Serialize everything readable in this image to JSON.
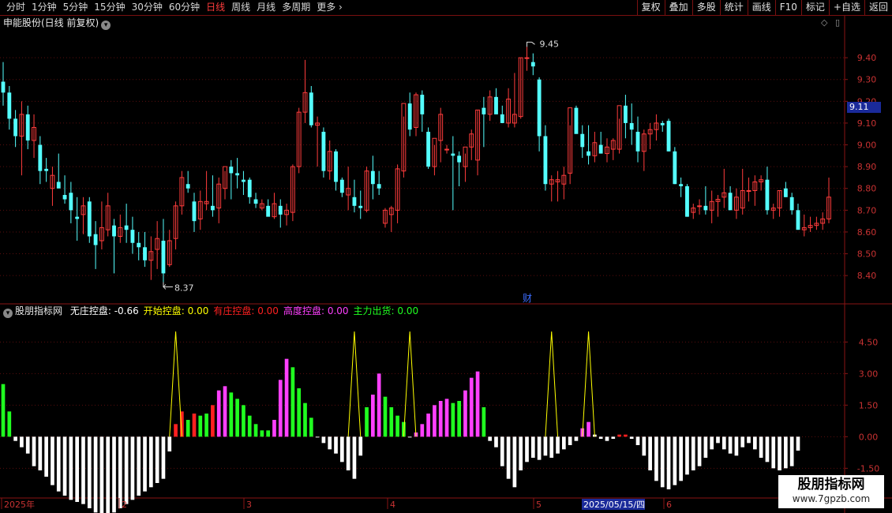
{
  "toolbar": {
    "periods": [
      "分时",
      "1分钟",
      "5分钟",
      "15分钟",
      "30分钟",
      "60分钟",
      "日线",
      "周线",
      "月线",
      "多周期",
      "更多 ›"
    ],
    "active_period": "日线",
    "right_buttons": [
      "复权",
      "叠加",
      "多股",
      "统计",
      "画线",
      "F10",
      "标记",
      "+自选",
      "返回"
    ]
  },
  "main_chart": {
    "title": "申能股份(日线 前复权)",
    "price_tag": "9.11",
    "y_ticks": [
      "9.40",
      "9.30",
      "9.20",
      "9.10",
      "9.00",
      "8.90",
      "8.80",
      "8.70",
      "8.60",
      "8.50",
      "8.40"
    ],
    "high_label": "9.45",
    "low_label": "8.37",
    "finance_marker": "财",
    "colors": {
      "up": "#ff3c3c",
      "down": "#54ffff"
    }
  },
  "indicator": {
    "name": "股朋指标网",
    "fields": [
      {
        "label": "无庄控盘:",
        "value": "-0.66",
        "color": "#ffffff"
      },
      {
        "label": "开始控盘:",
        "value": "0.00",
        "color": "#ffff00"
      },
      {
        "label": "有庄控盘:",
        "value": "0.00",
        "color": "#ff2020"
      },
      {
        "label": "高度控盘:",
        "value": "0.00",
        "color": "#ff40ff"
      },
      {
        "label": "主力出货:",
        "value": "0.00",
        "color": "#20ff20"
      }
    ],
    "y_ticks": [
      "4.50",
      "3.00",
      "1.50",
      "0.00",
      "-1.50"
    ]
  },
  "time_axis": {
    "labels": [
      "2025年",
      "2",
      "3",
      "4",
      "5",
      "6"
    ],
    "cursor_date": "2025/05/15/四"
  },
  "watermark": {
    "title": "股朋指标网",
    "url": "www.7gpzb.com"
  },
  "chart_data": {
    "type": "candlestick",
    "ohlc": [
      [
        9.29,
        9.38,
        9.18,
        9.24
      ],
      [
        9.24,
        9.27,
        9.07,
        9.12
      ],
      [
        9.12,
        9.16,
        8.99,
        9.04
      ],
      [
        9.04,
        9.2,
        8.86,
        9.14
      ],
      [
        9.14,
        9.18,
        8.98,
        9.02
      ],
      [
        9.02,
        9.14,
        8.94,
        9.08
      ],
      [
        9.0,
        9.04,
        8.82,
        8.88
      ],
      [
        8.89,
        8.94,
        8.83,
        8.88
      ],
      [
        8.8,
        8.9,
        8.72,
        8.86
      ],
      [
        8.83,
        8.96,
        8.8,
        8.8
      ],
      [
        8.77,
        8.86,
        8.73,
        8.75
      ],
      [
        8.78,
        8.83,
        8.64,
        8.7
      ],
      [
        8.67,
        8.76,
        8.56,
        8.66
      ],
      [
        8.68,
        8.76,
        8.59,
        8.72
      ],
      [
        8.74,
        8.76,
        8.55,
        8.58
      ],
      [
        8.59,
        8.65,
        8.43,
        8.54
      ],
      [
        8.56,
        8.74,
        8.52,
        8.62
      ],
      [
        8.61,
        8.78,
        8.58,
        8.72
      ],
      [
        8.63,
        8.66,
        8.41,
        8.58
      ],
      [
        8.58,
        8.68,
        8.55,
        8.62
      ],
      [
        8.63,
        8.73,
        8.55,
        8.61
      ],
      [
        8.61,
        8.67,
        8.5,
        8.55
      ],
      [
        8.55,
        8.6,
        8.47,
        8.53
      ],
      [
        8.53,
        8.6,
        8.44,
        8.47
      ],
      [
        8.47,
        8.58,
        8.38,
        8.51
      ],
      [
        8.52,
        8.65,
        8.43,
        8.57
      ],
      [
        8.56,
        8.66,
        8.37,
        8.41
      ],
      [
        8.45,
        8.61,
        8.44,
        8.56
      ],
      [
        8.57,
        8.74,
        8.52,
        8.72
      ],
      [
        8.72,
        8.88,
        8.68,
        8.85
      ],
      [
        8.82,
        8.88,
        8.78,
        8.8
      ],
      [
        8.74,
        8.78,
        8.6,
        8.65
      ],
      [
        8.66,
        8.79,
        8.61,
        8.74
      ],
      [
        8.73,
        8.88,
        8.7,
        8.74
      ],
      [
        8.72,
        8.86,
        8.67,
        8.7
      ],
      [
        8.71,
        8.85,
        8.64,
        8.82
      ],
      [
        8.8,
        8.88,
        8.75,
        8.9
      ],
      [
        8.9,
        8.93,
        8.75,
        8.87
      ],
      [
        8.87,
        8.94,
        8.8,
        8.86
      ],
      [
        8.84,
        8.88,
        8.77,
        8.83
      ],
      [
        8.84,
        8.85,
        8.73,
        8.76
      ],
      [
        8.75,
        8.78,
        8.71,
        8.73
      ],
      [
        8.71,
        8.75,
        8.7,
        8.73
      ],
      [
        8.72,
        8.75,
        8.68,
        8.67
      ],
      [
        8.67,
        8.78,
        8.66,
        8.73
      ],
      [
        8.72,
        8.75,
        8.62,
        8.68
      ],
      [
        8.68,
        8.73,
        8.63,
        8.7
      ],
      [
        8.69,
        8.91,
        8.65,
        8.9
      ],
      [
        8.9,
        9.17,
        8.87,
        9.15
      ],
      [
        9.15,
        9.39,
        9.1,
        9.24
      ],
      [
        9.24,
        9.27,
        9.08,
        9.09
      ],
      [
        9.09,
        9.13,
        8.9,
        9.1
      ],
      [
        9.06,
        9.08,
        8.85,
        8.88
      ],
      [
        8.88,
        9.02,
        8.84,
        8.97
      ],
      [
        8.97,
        8.98,
        8.79,
        8.83
      ],
      [
        8.84,
        8.85,
        8.76,
        8.78
      ],
      [
        8.77,
        8.9,
        8.7,
        8.8
      ],
      [
        8.76,
        8.84,
        8.69,
        8.72
      ],
      [
        8.72,
        8.79,
        8.66,
        8.71
      ],
      [
        8.7,
        8.9,
        8.69,
        8.88
      ],
      [
        8.88,
        8.95,
        8.75,
        8.82
      ],
      [
        8.82,
        8.88,
        8.77,
        8.8
      ],
      [
        8.64,
        8.71,
        8.62,
        8.7
      ],
      [
        8.68,
        8.72,
        8.6,
        8.71
      ],
      [
        8.7,
        8.91,
        8.64,
        8.89
      ],
      [
        8.88,
        9.13,
        8.85,
        9.19
      ],
      [
        9.19,
        9.24,
        9.04,
        9.07
      ],
      [
        9.08,
        9.24,
        9.04,
        9.23
      ],
      [
        9.23,
        9.25,
        9.06,
        9.14
      ],
      [
        9.06,
        9.08,
        8.89,
        8.9
      ],
      [
        8.9,
        9.0,
        8.86,
        9.03
      ],
      [
        9.02,
        9.17,
        8.92,
        9.14
      ],
      [
        8.98,
        9.0,
        8.96,
        8.98
      ],
      [
        8.96,
        9.04,
        8.7,
        8.95
      ],
      [
        8.95,
        8.97,
        8.81,
        8.92
      ],
      [
        8.9,
        8.96,
        8.83,
        8.99
      ],
      [
        8.99,
        9.07,
        8.93,
        9.05
      ],
      [
        8.93,
        9.16,
        8.86,
        9.16
      ],
      [
        9.17,
        9.22,
        8.99,
        9.14
      ],
      [
        9.14,
        9.25,
        9.11,
        9.22
      ],
      [
        9.22,
        9.26,
        9.16,
        9.14
      ],
      [
        9.14,
        9.18,
        9.1,
        9.1
      ],
      [
        9.1,
        9.26,
        9.08,
        9.21
      ],
      [
        9.1,
        9.33,
        9.08,
        9.14
      ],
      [
        9.13,
        9.4,
        9.12,
        9.4
      ],
      [
        9.4,
        9.45,
        9.34,
        9.4
      ],
      [
        9.38,
        9.42,
        9.32,
        9.36
      ],
      [
        9.3,
        9.31,
        8.97,
        9.04
      ],
      [
        9.04,
        9.09,
        8.79,
        8.82
      ],
      [
        8.82,
        8.86,
        8.74,
        8.84
      ],
      [
        8.83,
        8.88,
        8.74,
        8.84
      ],
      [
        8.82,
        8.9,
        8.75,
        8.86
      ],
      [
        8.87,
        9.09,
        8.82,
        9.17
      ],
      [
        9.17,
        9.18,
        9.06,
        9.05
      ],
      [
        9.05,
        9.09,
        8.94,
        8.99
      ],
      [
        8.97,
        9.09,
        8.91,
        8.95
      ],
      [
        8.95,
        9.06,
        8.92,
        9.01
      ],
      [
        9.0,
        9.06,
        8.96,
        8.96
      ],
      [
        8.96,
        9.03,
        8.92,
        8.99
      ],
      [
        8.98,
        9.03,
        8.93,
        9.02
      ],
      [
        8.98,
        9.12,
        8.96,
        9.18
      ],
      [
        9.18,
        9.23,
        9.03,
        9.1
      ],
      [
        9.1,
        9.19,
        9.0,
        9.07
      ],
      [
        9.06,
        9.13,
        8.92,
        8.97
      ],
      [
        8.97,
        9.07,
        8.88,
        9.05
      ],
      [
        9.05,
        9.1,
        8.98,
        9.07
      ],
      [
        9.07,
        9.14,
        9.02,
        9.1
      ],
      [
        9.1,
        9.11,
        9.06,
        9.09
      ],
      [
        9.11,
        9.12,
        8.97,
        8.97
      ],
      [
        8.97,
        8.99,
        8.82,
        8.82
      ],
      [
        8.82,
        8.85,
        8.76,
        8.81
      ],
      [
        8.81,
        8.82,
        8.67,
        8.67
      ],
      [
        8.69,
        8.73,
        8.66,
        8.71
      ],
      [
        8.72,
        8.75,
        8.68,
        8.72
      ],
      [
        8.72,
        8.81,
        8.68,
        8.7
      ],
      [
        8.7,
        8.79,
        8.64,
        8.74
      ],
      [
        8.74,
        8.77,
        8.67,
        8.75
      ],
      [
        8.76,
        8.89,
        8.71,
        8.78
      ],
      [
        8.78,
        8.81,
        8.72,
        8.7
      ],
      [
        8.7,
        8.8,
        8.66,
        8.76
      ],
      [
        8.71,
        8.89,
        8.68,
        8.79
      ],
      [
        8.79,
        8.85,
        8.74,
        8.79
      ],
      [
        8.79,
        8.86,
        8.72,
        8.83
      ],
      [
        8.83,
        8.86,
        8.79,
        8.84
      ],
      [
        8.84,
        8.9,
        8.68,
        8.7
      ],
      [
        8.7,
        8.73,
        8.66,
        8.71
      ],
      [
        8.71,
        8.79,
        8.67,
        8.79
      ],
      [
        8.8,
        8.83,
        8.76,
        8.76
      ],
      [
        8.76,
        8.78,
        8.68,
        8.7
      ],
      [
        8.7,
        8.73,
        8.62,
        8.61
      ],
      [
        8.61,
        8.68,
        8.58,
        8.62
      ],
      [
        8.62,
        8.67,
        8.6,
        8.63
      ],
      [
        8.63,
        8.67,
        8.61,
        8.64
      ],
      [
        8.64,
        8.69,
        8.61,
        8.66
      ],
      [
        8.66,
        8.85,
        8.64,
        8.76
      ]
    ],
    "indicator_bars": [
      {
        "v": 2.5,
        "c": "green"
      },
      {
        "v": 1.2,
        "c": "green"
      },
      {
        "v": -0.2,
        "c": "white"
      },
      {
        "v": -0.5,
        "c": "white"
      },
      {
        "v": -0.8,
        "c": "white"
      },
      {
        "v": -1.4,
        "c": "white"
      },
      {
        "v": -1.6,
        "c": "white"
      },
      {
        "v": -1.9,
        "c": "white"
      },
      {
        "v": -2.3,
        "c": "white"
      },
      {
        "v": -2.6,
        "c": "white"
      },
      {
        "v": -2.8,
        "c": "white"
      },
      {
        "v": -3.0,
        "c": "white"
      },
      {
        "v": -3.1,
        "c": "white"
      },
      {
        "v": -3.2,
        "c": "white"
      },
      {
        "v": -3.4,
        "c": "white"
      },
      {
        "v": -3.6,
        "c": "white"
      },
      {
        "v": -3.9,
        "c": "white"
      },
      {
        "v": -4.0,
        "c": "white"
      },
      {
        "v": -3.6,
        "c": "white"
      },
      {
        "v": -3.4,
        "c": "white"
      },
      {
        "v": -3.2,
        "c": "white"
      },
      {
        "v": -3.0,
        "c": "white"
      },
      {
        "v": -2.8,
        "c": "white"
      },
      {
        "v": -2.6,
        "c": "white"
      },
      {
        "v": -2.4,
        "c": "white"
      },
      {
        "v": -2.2,
        "c": "white"
      },
      {
        "v": -2.0,
        "c": "white"
      },
      {
        "v": -0.7,
        "c": "white"
      },
      {
        "v": 0.6,
        "c": "red"
      },
      {
        "v": 1.2,
        "c": "red"
      },
      {
        "v": 0.8,
        "c": "green"
      },
      {
        "v": 1.1,
        "c": "red"
      },
      {
        "v": 1.0,
        "c": "green"
      },
      {
        "v": 1.1,
        "c": "green"
      },
      {
        "v": 1.5,
        "c": "red"
      },
      {
        "v": 2.2,
        "c": "magenta"
      },
      {
        "v": 2.4,
        "c": "magenta"
      },
      {
        "v": 2.1,
        "c": "green"
      },
      {
        "v": 1.8,
        "c": "green"
      },
      {
        "v": 1.5,
        "c": "green"
      },
      {
        "v": 1.0,
        "c": "green"
      },
      {
        "v": 0.6,
        "c": "green"
      },
      {
        "v": 0.3,
        "c": "green"
      },
      {
        "v": 0.3,
        "c": "green"
      },
      {
        "v": 0.8,
        "c": "magenta"
      },
      {
        "v": 2.7,
        "c": "magenta"
      },
      {
        "v": 3.7,
        "c": "magenta"
      },
      {
        "v": 3.3,
        "c": "green"
      },
      {
        "v": 2.3,
        "c": "green"
      },
      {
        "v": 1.6,
        "c": "green"
      },
      {
        "v": 0.9,
        "c": "green"
      },
      {
        "v": 0.0,
        "c": "white"
      },
      {
        "v": -0.3,
        "c": "white"
      },
      {
        "v": -0.6,
        "c": "white"
      },
      {
        "v": -0.8,
        "c": "white"
      },
      {
        "v": -1.2,
        "c": "white"
      },
      {
        "v": -1.6,
        "c": "white"
      },
      {
        "v": -2.0,
        "c": "white"
      },
      {
        "v": -0.9,
        "c": "white"
      },
      {
        "v": 1.4,
        "c": "green"
      },
      {
        "v": 2.0,
        "c": "magenta"
      },
      {
        "v": 3.0,
        "c": "magenta"
      },
      {
        "v": 1.9,
        "c": "green"
      },
      {
        "v": 1.4,
        "c": "green"
      },
      {
        "v": 1.0,
        "c": "green"
      },
      {
        "v": 0.7,
        "c": "green"
      },
      {
        "v": 0.0,
        "c": "white"
      },
      {
        "v": 0.2,
        "c": "magenta"
      },
      {
        "v": 0.6,
        "c": "magenta"
      },
      {
        "v": 1.1,
        "c": "magenta"
      },
      {
        "v": 1.5,
        "c": "magenta"
      },
      {
        "v": 1.7,
        "c": "magenta"
      },
      {
        "v": 1.8,
        "c": "magenta"
      },
      {
        "v": 1.6,
        "c": "green"
      },
      {
        "v": 1.7,
        "c": "green"
      },
      {
        "v": 2.2,
        "c": "magenta"
      },
      {
        "v": 2.8,
        "c": "magenta"
      },
      {
        "v": 3.1,
        "c": "magenta"
      },
      {
        "v": 1.4,
        "c": "green"
      },
      {
        "v": -0.2,
        "c": "white"
      },
      {
        "v": -0.5,
        "c": "white"
      },
      {
        "v": -1.4,
        "c": "white"
      },
      {
        "v": -2.0,
        "c": "white"
      },
      {
        "v": -2.4,
        "c": "white"
      },
      {
        "v": -1.6,
        "c": "white"
      },
      {
        "v": -1.2,
        "c": "white"
      },
      {
        "v": -1.0,
        "c": "white"
      },
      {
        "v": -1.1,
        "c": "white"
      },
      {
        "v": -0.9,
        "c": "white"
      },
      {
        "v": -1.0,
        "c": "white"
      },
      {
        "v": -0.8,
        "c": "white"
      },
      {
        "v": -0.6,
        "c": "white"
      },
      {
        "v": -0.4,
        "c": "white"
      },
      {
        "v": -0.2,
        "c": "white"
      },
      {
        "v": 0.4,
        "c": "magenta"
      },
      {
        "v": 0.7,
        "c": "magenta"
      },
      {
        "v": 0.1,
        "c": "white"
      },
      {
        "v": -0.1,
        "c": "white"
      },
      {
        "v": -0.2,
        "c": "white"
      },
      {
        "v": -0.1,
        "c": "white"
      },
      {
        "v": 0.1,
        "c": "red"
      },
      {
        "v": 0.1,
        "c": "red"
      },
      {
        "v": -0.1,
        "c": "white"
      },
      {
        "v": -0.4,
        "c": "white"
      },
      {
        "v": -0.9,
        "c": "white"
      },
      {
        "v": -1.6,
        "c": "white"
      },
      {
        "v": -2.1,
        "c": "white"
      },
      {
        "v": -2.4,
        "c": "white"
      },
      {
        "v": -2.5,
        "c": "white"
      },
      {
        "v": -2.3,
        "c": "white"
      },
      {
        "v": -2.1,
        "c": "white"
      },
      {
        "v": -1.8,
        "c": "white"
      },
      {
        "v": -1.6,
        "c": "white"
      },
      {
        "v": -1.4,
        "c": "white"
      },
      {
        "v": -1.0,
        "c": "white"
      },
      {
        "v": -0.6,
        "c": "white"
      },
      {
        "v": -0.3,
        "c": "white"
      },
      {
        "v": -0.6,
        "c": "white"
      },
      {
        "v": -0.8,
        "c": "white"
      },
      {
        "v": -0.9,
        "c": "white"
      },
      {
        "v": -0.5,
        "c": "white"
      },
      {
        "v": -0.3,
        "c": "white"
      },
      {
        "v": -0.6,
        "c": "white"
      },
      {
        "v": -1.0,
        "c": "white"
      },
      {
        "v": -1.2,
        "c": "white"
      },
      {
        "v": -1.5,
        "c": "white"
      },
      {
        "v": -1.6,
        "c": "white"
      },
      {
        "v": -1.5,
        "c": "white"
      },
      {
        "v": -1.4,
        "c": "white"
      },
      {
        "v": -0.66,
        "c": "white"
      }
    ],
    "signal_peaks": [
      28,
      57,
      66,
      89,
      95
    ],
    "signal_peak_value": 5.0,
    "y_range_price": [
      8.31,
      9.52
    ],
    "y_range_indicator": [
      -2.8,
      5.6
    ]
  }
}
